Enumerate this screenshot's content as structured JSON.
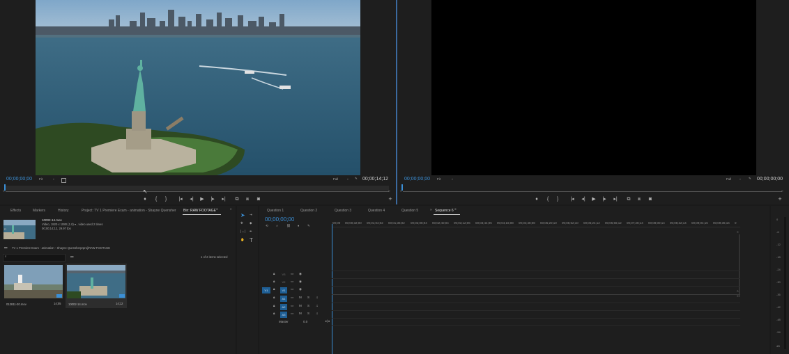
{
  "source_monitor": {
    "timecode_in": "00;00;00;00",
    "fit_label": "Fit",
    "quality_label": "Full",
    "timecode_out": "00;00;14;12"
  },
  "program_monitor": {
    "timecode_in": "00;00;00;00",
    "fit_label": "Fit",
    "quality_label": "Full",
    "timecode_out": "00;00;00;00"
  },
  "transport_glyphs": {
    "marker": "♦",
    "in": "{",
    "out": "}",
    "go_in": "|◂",
    "step_back": "◂|",
    "play": "▶",
    "step_fwd": "|▸",
    "go_out": "▸|",
    "insert": "⧉",
    "overwrite": "⧈",
    "export_frame": "◙",
    "add": "+"
  },
  "project_tabs": [
    "Effects",
    "Markers",
    "History",
    "Project: TV 1 Premiere Exam - animation - Shayne Quensher",
    "Bin: RAW FOOTAGE"
  ],
  "clip_info": {
    "name": "10002-14.mov",
    "line1": "Video, 1920 x 1080 (1.0) ▾ , video used 2 times",
    "line2": "00;00;14;12, 29.97 fps"
  },
  "bin_path": "TV 1 Premiere Exam - animation - Shayne Quensherprproj\\RAW FOOTAGE",
  "items_selected": "1 of 2 items selected",
  "thumbnails": [
    {
      "name": "012811-20.mov",
      "duration": "14;05"
    },
    {
      "name": "10002-14.mov",
      "duration": "14;12"
    }
  ],
  "sequence_tabs": [
    "Question 1",
    "Question 2",
    "Question 3",
    "Question 4",
    "Question 5",
    "Sequence 6"
  ],
  "timeline": {
    "timecode": "00;00;00;00",
    "ruler": [
      "00;00",
      "00;00;32;00",
      "00;01;04;02",
      "00;01;36;02",
      "00;02;08;04",
      "00;02;40;04",
      "00;03;12;06",
      "00;03;44;06",
      "00;04;16;08",
      "00;04;48;08",
      "00;05;20;10",
      "00;05;52;10",
      "00;06;24;12",
      "00;06;56;12",
      "00;07;28;14",
      "00;08;00;14",
      "00;08;32;14",
      "00;09;04;16",
      "00;09;36;16",
      "0"
    ],
    "video_tracks": [
      "V3",
      "V2",
      "V1"
    ],
    "audio_tracks": [
      "A1",
      "A2",
      "A3"
    ],
    "source_patch_video": "V1",
    "master_label": "Master",
    "master_value": "0.0",
    "track_m": "M",
    "track_s": "S"
  },
  "meter_scale": [
    "0",
    "-6",
    "-12",
    "-18",
    "-24",
    "-30",
    "-36",
    "-42",
    "-48",
    "-54",
    "dB"
  ],
  "icons": [
    "wrench-icon",
    "selection-tool-icon",
    "razor-tool-icon",
    "hand-tool-icon",
    "type-tool-icon",
    "folder-icon",
    "search-icon",
    "lock-icon",
    "eye-icon",
    "mic-icon"
  ],
  "colors": {
    "accent": "#3b8fd6",
    "panel": "#1e1e1e",
    "background": "#1a1a1a"
  }
}
